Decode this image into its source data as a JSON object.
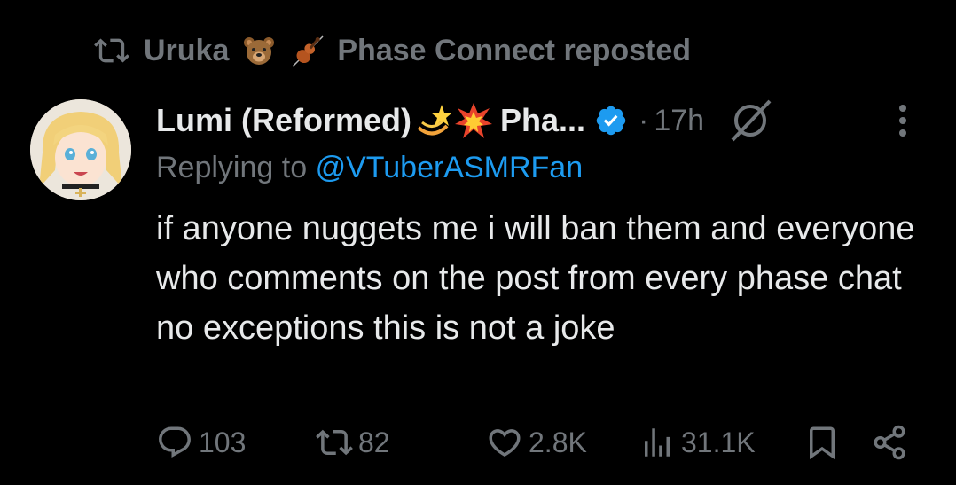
{
  "repost": {
    "prefix": "Uruka",
    "suffix": "Phase Connect reposted",
    "emojis": [
      "bear-emoji",
      "violin-emoji"
    ]
  },
  "tweet": {
    "display_name": "Lumi (Reformed)",
    "name_emojis": [
      "dizzy-emoji",
      "collision-emoji"
    ],
    "name_truncated": "Pha...",
    "separator": "·",
    "time": "17h",
    "replying_label": "Replying to",
    "replying_handle": "@VTuberASMRFan",
    "text": "if anyone nuggets me i will ban them and everyone who comments on the post from every phase chat no exceptions this is not a joke"
  },
  "actions": {
    "replies": "103",
    "reposts": "82",
    "likes": "2.8K",
    "views": "31.1K"
  },
  "colors": {
    "background": "#000000",
    "text": "#e7e9ea",
    "muted": "#71767b",
    "link": "#1d9bf0",
    "verified": "#1d9bf0"
  }
}
